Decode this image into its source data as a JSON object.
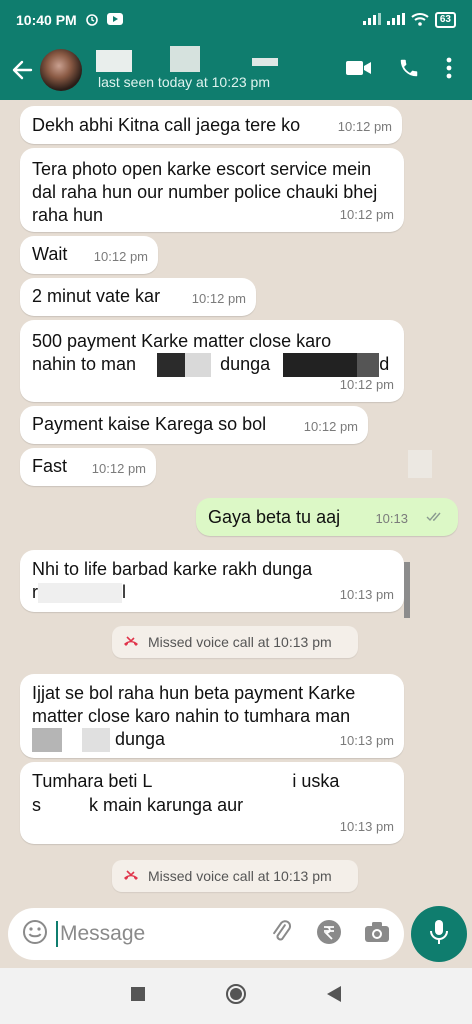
{
  "status_bar": {
    "time": "10:40 PM",
    "battery": "63"
  },
  "header": {
    "last_seen": "last seen today at 10:23 pm"
  },
  "messages": [
    {
      "text": "Dekh abhi Kitna call jaega tere ko",
      "time": "10:12 pm"
    },
    {
      "text": "Tera photo open karke escort service mein dal raha hun our number police chauki bhej raha hun",
      "time": "10:12 pm"
    },
    {
      "text": "Wait",
      "time": "10:12 pm"
    },
    {
      "text": "2 minut vate kar",
      "time": "10:12 pm"
    },
    {
      "line1": "500 payment Karke matter close karo",
      "line2a": "nahin to man",
      "line2b": "dunga",
      "line2c": "d",
      "time": "10:12 pm"
    },
    {
      "text": "Payment kaise Karega so bol",
      "time": "10:12 pm"
    },
    {
      "text": "Fast",
      "time": "10:12 pm"
    },
    {
      "text": "Gaya beta tu aaj",
      "time": "10:13"
    },
    {
      "line1": "Nhi to life barbad karke rakh dunga",
      "line2a": "r",
      "line2b": "l",
      "time": "10:13 pm"
    },
    {
      "line1": "Ijjat se bol raha hun beta payment Karke",
      "line2": "matter close karo nahin to tumhara man",
      "line3": "dunga",
      "time": "10:13 pm"
    },
    {
      "line1a": "Tumhara beti L",
      "line1b": "i uska",
      "line2a": "s",
      "line2b": "k main karunga aur",
      "time": "10:13 pm"
    }
  ],
  "system_messages": [
    {
      "text": "Missed voice call at 10:13 pm"
    },
    {
      "text": "Missed voice call at 10:13 pm"
    }
  ],
  "input": {
    "placeholder": "Message"
  },
  "colors": {
    "header": "#0f7d6e",
    "outgoing_bubble": "#dcf8c6",
    "incoming_bubble": "#ffffff",
    "missed_call": "#e0344b"
  },
  "icons": [
    "back-arrow-icon",
    "video-call-icon",
    "phone-call-icon",
    "more-options-icon",
    "emoji-icon",
    "attach-icon",
    "rupee-payment-icon",
    "camera-icon",
    "mic-icon",
    "missed-call-icon"
  ]
}
